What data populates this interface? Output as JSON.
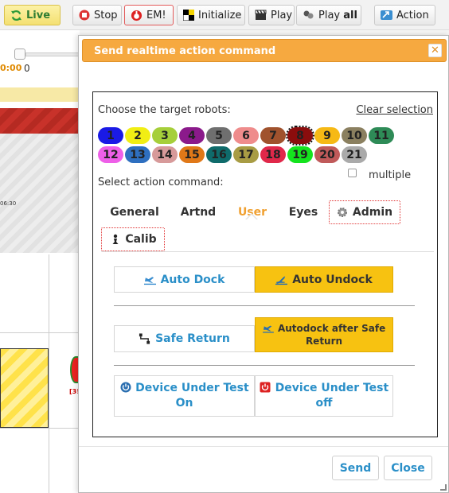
{
  "toolbar": {
    "live": "Live",
    "stop": "Stop",
    "em": "EM!",
    "initialize": "Initialize",
    "play": "Play",
    "play_all_prefix": "Play",
    "play_all_bold": "all",
    "action": "Action"
  },
  "background": {
    "time_value": "0:00",
    "counter_value": "0",
    "tiny_time": "06:30",
    "robot_code": "[3!"
  },
  "dialog": {
    "title": "Send realtime action command",
    "close_glyph": "✕",
    "choose_label": "Choose the target robots:",
    "clear_selection": "Clear selection",
    "multiple_label": "multiple",
    "select_label": "Select action command:",
    "robots": [
      {
        "id": "1",
        "color": "#1a1ae6",
        "selected": false
      },
      {
        "id": "2",
        "color": "#f1ee14",
        "selected": false
      },
      {
        "id": "3",
        "color": "#a6cf3a",
        "selected": false
      },
      {
        "id": "4",
        "color": "#8b1a8b",
        "selected": false
      },
      {
        "id": "5",
        "color": "#6f6f6f",
        "selected": false
      },
      {
        "id": "6",
        "color": "#ef8c8c",
        "selected": false
      },
      {
        "id": "7",
        "color": "#a0522d",
        "selected": false
      },
      {
        "id": "8",
        "color": "#8b0d0d",
        "selected": true
      },
      {
        "id": "9",
        "color": "#f6b915",
        "selected": false
      },
      {
        "id": "10",
        "color": "#8b8060",
        "selected": false
      },
      {
        "id": "11",
        "color": "#2e8b57",
        "selected": false
      },
      {
        "id": "12",
        "color": "#ee5fe8",
        "selected": false
      },
      {
        "id": "13",
        "color": "#2e6fc0",
        "selected": false
      },
      {
        "id": "14",
        "color": "#d79a9a",
        "selected": false
      },
      {
        "id": "15",
        "color": "#e07818",
        "selected": false
      },
      {
        "id": "16",
        "color": "#0f6b6b",
        "selected": false
      },
      {
        "id": "17",
        "color": "#a89c44",
        "selected": false
      },
      {
        "id": "18",
        "color": "#e0284a",
        "selected": false
      },
      {
        "id": "19",
        "color": "#14e31e",
        "selected": false
      },
      {
        "id": "20",
        "color": "#c05a5a",
        "selected": false
      },
      {
        "id": "21",
        "color": "#aaaaaa",
        "selected": false
      }
    ],
    "tabs": [
      {
        "label": "General",
        "active": false
      },
      {
        "label": "Artnd",
        "active": false
      },
      {
        "label": "User",
        "active": true
      },
      {
        "label": "Eyes",
        "active": false
      },
      {
        "label": "Admin",
        "active": false
      },
      {
        "label": "Calib",
        "active": false
      }
    ],
    "actions": {
      "auto_dock": "Auto Dock",
      "auto_undock": "Auto Undock",
      "safe_return": "Safe Return",
      "autodock_after_safe_return": "Autodock after Safe Return",
      "dut_on_line1": "Device Under Test",
      "dut_on_line2": "On",
      "dut_off_line1": "Device Under Test",
      "dut_off_line2": "off"
    },
    "footer": {
      "send": "Send",
      "close": "Close"
    }
  },
  "colors": {
    "header_orange": "#f6a940",
    "action_yellow": "#f7c211",
    "link_blue": "#2a8fc8",
    "active_tab_orange": "#f0a030"
  }
}
